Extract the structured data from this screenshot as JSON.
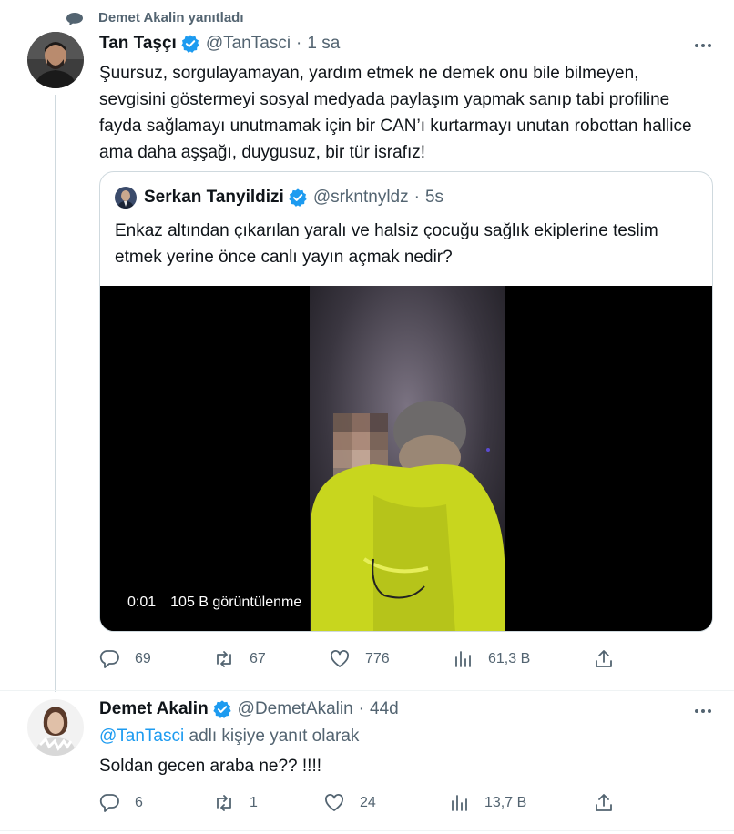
{
  "context": {
    "label": "Demet Akalin yanıtladı"
  },
  "main_tweet": {
    "name": "Tan Taşçı",
    "handle": "@TanTasci",
    "separator": "·",
    "time": "1 sa",
    "text": "Şuursuz, sorgulayamayan, yardım etmek ne demek onu bile bilmeyen, sevgisini göstermeyi sosyal medyada paylaşım yapmak sanıp tabi profiline fayda sağlamayı unutmamak için bir CAN’ı kurtarmayı unutan robottan hallice ama daha aşşağı, duygusuz, bir tür israfız!",
    "quote": {
      "name": "Serkan Tanyildizi",
      "handle": "@srkntnyldz",
      "separator": "·",
      "time": "5s",
      "text": "Enkaz altından çıkarılan yaralı ve halsiz çocuğu sağlık ekiplerine teslim etmek yerine önce canlı yayın açmak nedir?",
      "video_time": "0:01",
      "video_views": "105 B görüntülenme"
    },
    "stats": {
      "replies": "69",
      "retweets": "67",
      "likes": "776",
      "views": "61,3 B"
    }
  },
  "reply_tweet": {
    "name": "Demet Akalin",
    "handle": "@DemetAkalin",
    "separator": "·",
    "time": "44d",
    "mention": "@TanTasci",
    "reply_suffix": " adlı kişiye yanıt olarak",
    "text": "Soldan gecen araba ne?? !!!!",
    "stats": {
      "replies": "6",
      "retweets": "1",
      "likes": "24",
      "views": "13,7 B"
    }
  },
  "colors": {
    "accent": "#1d9bf0",
    "secondary_text": "#536471",
    "primary_text": "#0f1419",
    "border": "#cfd9de"
  },
  "icons": [
    "speech-bubble-icon",
    "verified-badge-icon",
    "more-icon",
    "reply-icon",
    "retweet-icon",
    "like-icon",
    "views-icon",
    "share-icon"
  ]
}
